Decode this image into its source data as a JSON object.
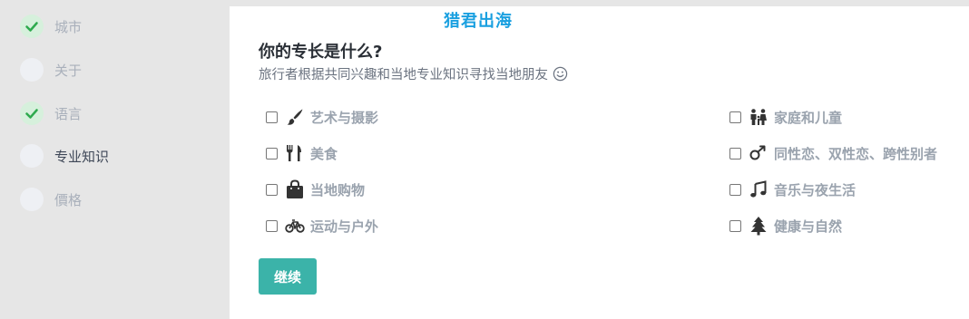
{
  "sidebar": {
    "steps": [
      {
        "label": "城市",
        "done": true,
        "active": false
      },
      {
        "label": "关于",
        "done": false,
        "active": false
      },
      {
        "label": "语言",
        "done": true,
        "active": false
      },
      {
        "label": "专业知识",
        "done": false,
        "active": true
      },
      {
        "label": "價格",
        "done": false,
        "active": false
      }
    ]
  },
  "watermark": "猎君出海",
  "main": {
    "title": "你的专长是什么?",
    "subtitle": "旅行者根据共同兴趣和当地专业知识寻找当地朋友",
    "options_left": [
      {
        "label": "艺术与摄影",
        "icon": "paintbrush-icon",
        "checked": false
      },
      {
        "label": "美食",
        "icon": "fork-knife-icon",
        "checked": false
      },
      {
        "label": "当地购物",
        "icon": "shopping-bag-icon",
        "checked": false
      },
      {
        "label": "运动与户外",
        "icon": "bicycle-icon",
        "checked": false
      }
    ],
    "options_right": [
      {
        "label": "家庭和儿童",
        "icon": "family-icon",
        "checked": false
      },
      {
        "label": "同性恋、双性恋、跨性别者",
        "icon": "gender-symbol-icon",
        "checked": false
      },
      {
        "label": "音乐与夜生活",
        "icon": "music-note-icon",
        "checked": false
      },
      {
        "label": "健康与自然",
        "icon": "tree-icon",
        "checked": false
      }
    ],
    "continue_label": "继续"
  },
  "colors": {
    "accent": "#3bb3a9",
    "check_green": "#2eaa4e",
    "watermark": "#1aa0e0"
  }
}
